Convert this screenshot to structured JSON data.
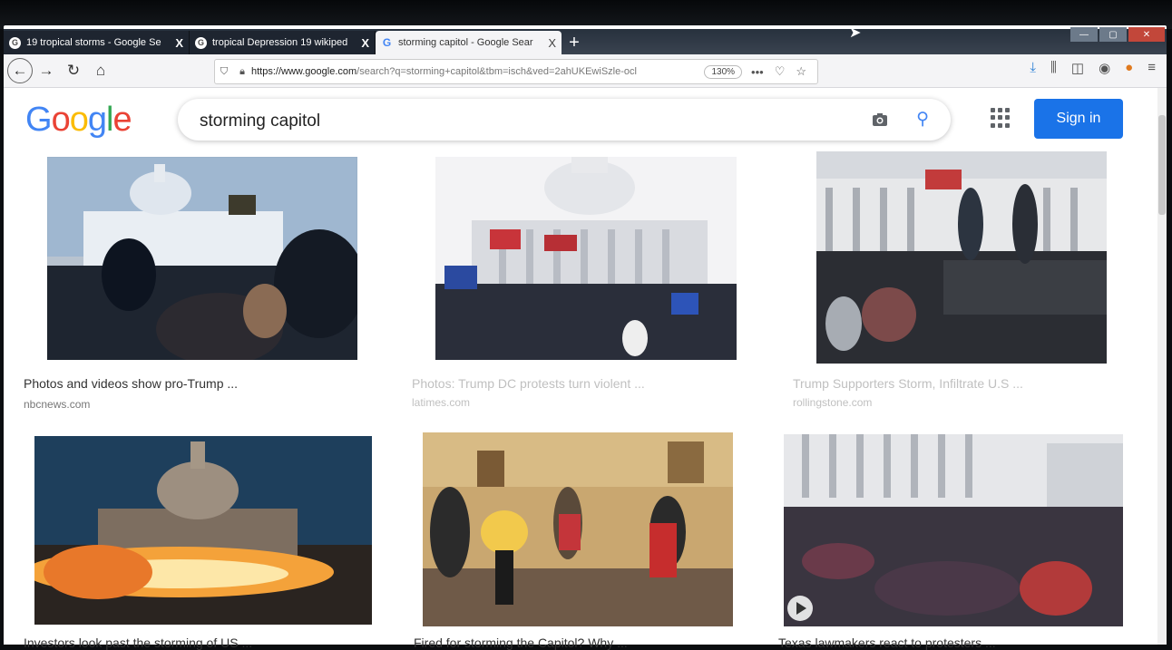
{
  "browser": {
    "tabs": [
      {
        "title": "19 tropical storms - Google Se",
        "close": "X",
        "active": false
      },
      {
        "title": "tropical Depression 19 wikiped",
        "close": "X",
        "active": false
      },
      {
        "title": "storming capitol - Google Sear",
        "close": "X",
        "active": true
      }
    ],
    "new_tab": "+",
    "url_host": "https://www.google.com",
    "url_rest": "/search?q=storming+capitol&tbm=isch&ved=2ahUKEwiSzle-ocl",
    "zoom": "130%"
  },
  "google": {
    "logo_letters": [
      "G",
      "o",
      "o",
      "g",
      "l",
      "e"
    ],
    "query": "storming capitol",
    "sign_in": "Sign in"
  },
  "results": [
    {
      "caption": "Photos and videos show pro-Trump ...",
      "source": "nbcnews.com"
    },
    {
      "caption": "Photos: Trump DC protests turn violent ...",
      "source": "latimes.com"
    },
    {
      "caption": "Trump Supporters Storm, Infiltrate U.S ...",
      "source": "rollingstone.com"
    },
    {
      "caption": "Investors look past the storming of US ...",
      "source": ""
    },
    {
      "caption": "Fired for storming the Capitol? Why ...",
      "source": ""
    },
    {
      "caption": "Texas lawmakers react to protesters ...",
      "source": ""
    }
  ],
  "icons": [
    "back-icon",
    "forward-icon",
    "reload-icon",
    "home-icon",
    "shield-icon",
    "lock-icon",
    "more-icon",
    "pocket-icon",
    "star-icon",
    "download-icon",
    "library-icon",
    "sidebar-icon",
    "account-icon",
    "extension-icon",
    "menu-icon",
    "camera-icon",
    "search-icon",
    "apps-icon",
    "play-icon"
  ]
}
